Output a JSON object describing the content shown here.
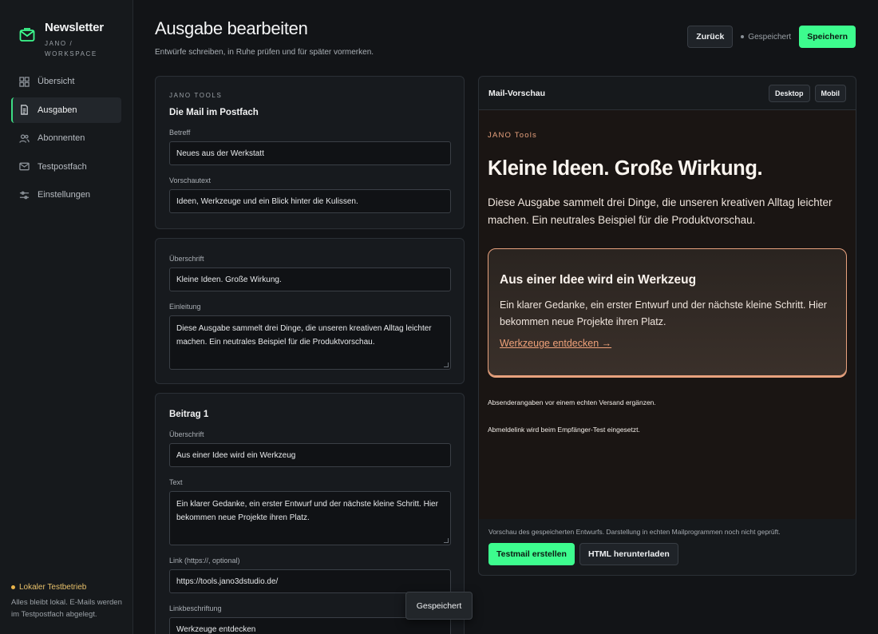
{
  "sidebar": {
    "brand_title": "Newsletter",
    "brand_sub": "JANO / WORKSPACE",
    "items": [
      {
        "label": "Übersicht",
        "icon": "grid-icon"
      },
      {
        "label": "Ausgaben",
        "icon": "document-icon",
        "active": true
      },
      {
        "label": "Abonnenten",
        "icon": "users-icon"
      },
      {
        "label": "Testpostfach",
        "icon": "mail-icon"
      },
      {
        "label": "Einstellungen",
        "icon": "sliders-icon"
      }
    ],
    "status": "Lokaler Testbetrieb",
    "status_desc": "Alles bleibt lokal. E-Mails werden im Testpostfach abgelegt."
  },
  "header": {
    "title": "Ausgabe bearbeiten",
    "subtitle": "Entwürfe schreiben, in Ruhe prüfen und für später vormerken.",
    "back_label": "Zurück",
    "saved_label": "Gespeichert",
    "save_label": "Speichern"
  },
  "mail_card": {
    "eyebrow": "JANO TOOLS",
    "title": "Die Mail im Postfach",
    "subject_label": "Betreff",
    "subject_value": "Neues aus der Werkstatt",
    "preview_label": "Vorschautext",
    "preview_value": "Ideen, Werkzeuge und ein Blick hinter die Kulissen."
  },
  "content_card": {
    "heading_label": "Überschrift",
    "heading_value": "Kleine Ideen. Große Wirkung.",
    "intro_label": "Einleitung",
    "intro_value": "Diese Ausgabe sammelt drei Dinge, die unseren kreativen Alltag leichter machen. Ein neutrales Beispiel für die Produktvorschau."
  },
  "post_card": {
    "title": "Beitrag 1",
    "heading_label": "Überschrift",
    "heading_value": "Aus einer Idee wird ein Werkzeug",
    "text_label": "Text",
    "text_value": "Ein klarer Gedanke, ein erster Entwurf und der nächste kleine Schritt. Hier bekommen neue Projekte ihren Platz.",
    "link_label": "Link (https://, optional)",
    "link_value": "https://tools.jano3dstudio.de/",
    "link_text_label": "Linkbeschriftung",
    "link_text_value": "Werkzeuge entdecken"
  },
  "toast": "Gespeichert",
  "preview": {
    "title": "Mail-Vorschau",
    "desktop_label": "Desktop",
    "mobile_label": "Mobil",
    "mail": {
      "brand": "JANO Tools",
      "heading": "Kleine Ideen. Große Wirkung.",
      "intro": "Diese Ausgabe sammelt drei Dinge, die unseren kreativen Alltag leichter machen. Ein neutrales Beispiel für die Produktvorschau.",
      "box_title": "Aus einer Idee wird ein Werkzeug",
      "box_text": "Ein klarer Gedanke, ein erster Entwurf und der nächste kleine Schritt. Hier bekommen neue Projekte ihren Platz.",
      "box_link": "Werkzeuge entdecken →",
      "note1": "Absenderangaben vor einem echten Versand ergänzen.",
      "note2": "Abmeldelink wird beim Empfänger-Test eingesetzt."
    },
    "hint": "Vorschau des gespeicherten Entwurfs. Darstellung in echten Mailprogrammen noch nicht geprüft.",
    "testmail_label": "Testmail erstellen",
    "html_label": "HTML herunterladen"
  },
  "colors": {
    "accent": "#3dfc8e",
    "warning": "#e8b34a",
    "mail_accent": "#e8a27e"
  }
}
